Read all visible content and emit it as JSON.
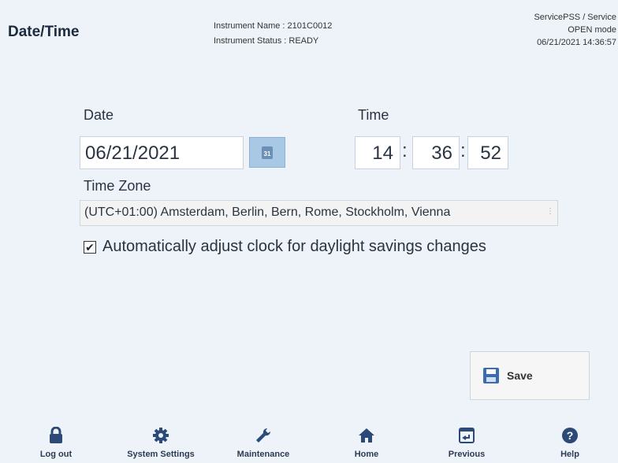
{
  "header": {
    "title": "Date/Time",
    "instrument_name": "Instrument Name : 2101C0012",
    "instrument_status": "Instrument Status : READY",
    "user": "ServicePSS / Service",
    "mode": "OPEN mode",
    "datetime": "06/21/2021 14:36:57"
  },
  "form": {
    "date_label": "Date",
    "date_value": "06/21/2021",
    "time_label": "Time",
    "hour": "14",
    "minute": "36",
    "second": "52",
    "colon": ":",
    "timezone_label": "Time Zone",
    "timezone_value": "(UTC+01:00) Amsterdam, Berlin, Bern, Rome, Stockholm, Vienna",
    "dst_label": "Automatically adjust clock for daylight savings changes",
    "dst_checked": true,
    "calendar_icon_text": "31"
  },
  "actions": {
    "save_label": "Save"
  },
  "nav": {
    "logout": "Log out",
    "system_settings": "System Settings",
    "maintenance": "Maintenance",
    "home": "Home",
    "previous": "Previous",
    "help": "Help"
  },
  "colors": {
    "background": "#eef3f9",
    "icon_blue": "#2c4a78",
    "calendar_button": "#a8c8e6"
  }
}
